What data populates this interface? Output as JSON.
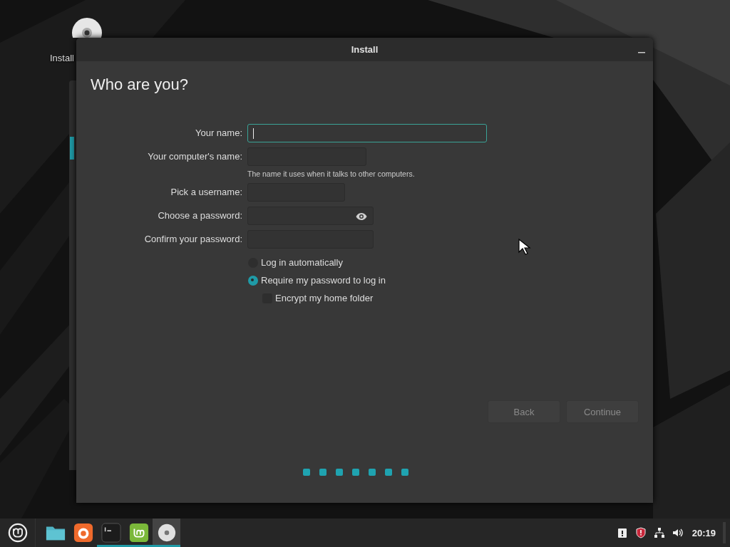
{
  "desktop_icons": [
    {
      "label": "Install",
      "kind": "disc"
    }
  ],
  "window": {
    "title": "Install"
  },
  "page": {
    "heading": "Who are you?",
    "fields": [
      {
        "label": "Your name:",
        "kind": "text",
        "focused": true
      },
      {
        "label": "Your computer's name:",
        "kind": "text",
        "focused": false,
        "hint": "The name it uses when it talks to other computers."
      },
      {
        "label": "Pick a username:",
        "kind": "text",
        "focused": false
      },
      {
        "label": "Choose a password:",
        "kind": "password",
        "focused": false
      },
      {
        "label": "Confirm your password:",
        "kind": "text",
        "focused": false
      }
    ],
    "options": [
      {
        "kind": "radio",
        "label": "Log in automatically",
        "selected": false
      },
      {
        "kind": "radio",
        "label": "Require my password to log in",
        "selected": true,
        "children": [
          {
            "kind": "checkbox",
            "label": "Encrypt my home folder",
            "checked": false
          }
        ]
      }
    ],
    "buttons": [
      {
        "label": "Back",
        "disabled": true
      },
      {
        "label": "Continue",
        "disabled": true
      }
    ],
    "steps": [
      {
        "completed": true
      },
      {
        "completed": true
      },
      {
        "completed": true
      },
      {
        "completed": true
      },
      {
        "completed": true
      },
      {
        "completed": true
      },
      {
        "completed": true
      }
    ]
  },
  "taskbar": {
    "launchers": [
      {
        "kind": "menu",
        "running": false,
        "active": false
      },
      {
        "kind": "files",
        "running": false,
        "active": false
      },
      {
        "kind": "browser",
        "running": false,
        "active": false
      },
      {
        "kind": "terminal",
        "running": true,
        "active": false
      },
      {
        "kind": "software",
        "running": true,
        "active": false
      },
      {
        "kind": "disc",
        "running": true,
        "active": true
      }
    ],
    "tray": [
      {
        "kind": "clipboard"
      },
      {
        "kind": "shield"
      },
      {
        "kind": "network"
      },
      {
        "kind": "volume"
      }
    ],
    "clock": "20:19"
  }
}
